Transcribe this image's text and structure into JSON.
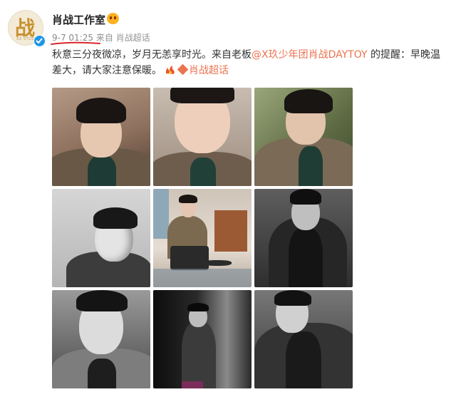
{
  "user": {
    "name": "肖战工作室",
    "avatar_glyph": "战",
    "avatar_subtext": "XZ STUDIO",
    "verified": true
  },
  "meta": {
    "time": "9-7 01:25",
    "source_prefix": "来自",
    "source": "肖战超话"
  },
  "post": {
    "text_before": "秋意三分夜微凉，岁月无恙享时光。来自老板",
    "mention": "@X玖少年团肖战DAYTOY",
    "text_after": " 的提醒：早晚温差大，请大家注意保暖。",
    "topic_link": "肖战超话"
  },
  "colors": {
    "link": "#eb7350",
    "verified": "#1d96e8",
    "underline": "#d9272e"
  },
  "photos": [
    {
      "label": "photo-1",
      "style": "color",
      "bg": "#a98f7d"
    },
    {
      "label": "photo-2",
      "style": "color",
      "bg": "#b7a89a"
    },
    {
      "label": "photo-3",
      "style": "color",
      "bg": "#7e8a63"
    },
    {
      "label": "photo-4",
      "style": "bw",
      "bg": "#c8c8c8"
    },
    {
      "label": "photo-5",
      "style": "color",
      "bg": "#d8cfc4"
    },
    {
      "label": "photo-6",
      "style": "bw",
      "bg": "#4a4a4a"
    },
    {
      "label": "photo-7",
      "style": "bw",
      "bg": "#6d6d6d"
    },
    {
      "label": "photo-8",
      "style": "bw",
      "bg": "#1c1c1c"
    },
    {
      "label": "photo-9",
      "style": "bw",
      "bg": "#5c5c5c"
    }
  ]
}
